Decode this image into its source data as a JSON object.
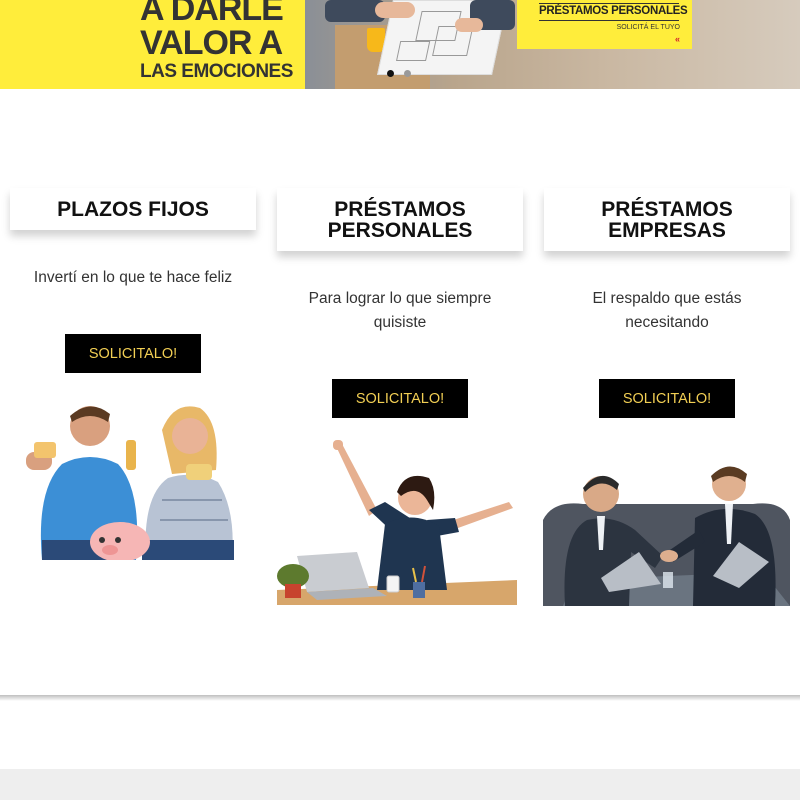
{
  "hero": {
    "headline": [
      "A DARLE",
      "VALOR A",
      "LAS EMOCIONES"
    ],
    "promo_title": "PRÉSTAMOS PERSONALES",
    "promo_subtitle": "SOLICITÁ EL TUYO",
    "promo_chevron": "«",
    "slides": 2,
    "active_slide": 1,
    "colors": {
      "yellow": "#ffed3b",
      "text": "#333333",
      "accent_red": "#d2232a"
    }
  },
  "cards": [
    {
      "title": "PLAZOS FIJOS",
      "description": "Invertí en lo que te hace feliz",
      "button_label": "SOLICITALO!",
      "image": "couple-with-piggy-bank"
    },
    {
      "title": "PRÉSTAMOS PERSONALES",
      "description": "Para lograr lo que siempre quisiste",
      "button_label": "SOLICITALO!",
      "image": "woman-celebrating-at-desk"
    },
    {
      "title": "PRÉSTAMOS EMPRESAS",
      "description": "El respaldo que estás necesitando",
      "button_label": "SOLICITALO!",
      "image": "businessmen-handshake"
    }
  ],
  "theme": {
    "button_bg": "#000000",
    "button_text": "#f2cf54",
    "footer_bg": "#eeeeee"
  }
}
